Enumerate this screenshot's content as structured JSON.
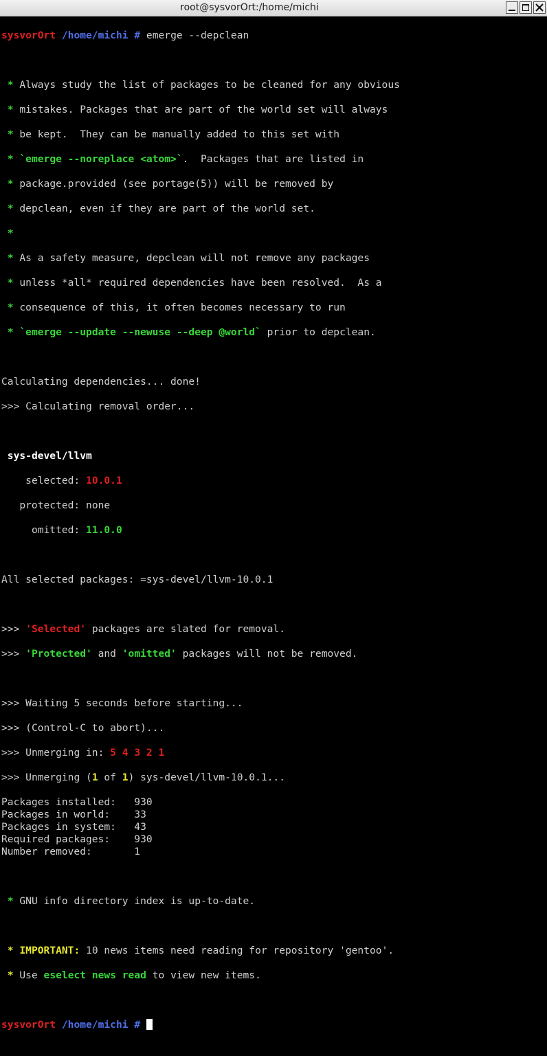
{
  "window": {
    "title": "root@sysvorOrt:/home/michi",
    "buttons": {
      "minimize_icon": "minimize-icon",
      "maximize_icon": "maximize-icon",
      "close_icon": "close-icon"
    }
  },
  "colors": {
    "host": "#e02020",
    "path": "#4f6fe8",
    "star": "#39d639",
    "important": "#e8e830"
  },
  "prompt": {
    "host": "sysvorOrt",
    "path": "/home/michi",
    "symbol": "#"
  },
  "command": "emerge --depclean",
  "warning": {
    "l1": "Always study the list of packages to be cleaned for any obvious",
    "l2": "mistakes. Packages that are part of the world set will always",
    "l3": "be kept.  They can be manually added to this set with",
    "l4_cmd": "`emerge --noreplace <atom>`",
    "l4_rest": ".  Packages that are listed in",
    "l5": "package.provided (see portage(5)) will be removed by",
    "l6": "depclean, even if they are part of the world set.",
    "l8": "As a safety measure, depclean will not remove any packages",
    "l9": "unless *all* required dependencies have been resolved.  As a",
    "l10": "consequence of this, it often becomes necessary to run",
    "l11_cmd": "`emerge --update --newuse --deep @world`",
    "l11_rest": " prior to depclean."
  },
  "calc": {
    "deps": "Calculating dependencies... done!",
    "order": ">>> Calculating removal order..."
  },
  "package": {
    "name": "sys-devel/llvm",
    "selected_label": "selected:",
    "selected_value": "10.0.1",
    "protected_label": "protected:",
    "protected_value": "none",
    "omitted_label": "omitted:",
    "omitted_value": "11.0.0"
  },
  "all_selected": "All selected packages: =sys-devel/llvm-10.0.1",
  "notes": {
    "arrow": ">>>",
    "selected_word": "'Selected'",
    "selected_rest": " packages are slated for removal.",
    "protected_word": "'Protected'",
    "and": " and ",
    "omitted_word": "'omitted'",
    "omitted_rest": " packages will not be removed."
  },
  "unmerge": {
    "waiting": "Waiting 5 seconds before starting...",
    "abort": "(Control-C to abort)...",
    "unmerging_in": "Unmerging in: ",
    "countdown": "5 4 3 2 1",
    "unmerging_pre": "Unmerging (",
    "cur": "1",
    "of": " of ",
    "total": "1",
    "unmerging_post": ") sys-devel/llvm-10.0.1..."
  },
  "stats": [
    {
      "label": "Packages installed:",
      "value": "930"
    },
    {
      "label": "Packages in world:",
      "value": "33"
    },
    {
      "label": "Packages in system:",
      "value": "43"
    },
    {
      "label": "Required packages:",
      "value": "930"
    },
    {
      "label": "Number removed:",
      "value": "1"
    }
  ],
  "info": "GNU info directory index is up-to-date.",
  "news": {
    "important": "IMPORTANT:",
    "important_rest": " 10 news items need reading for repository 'gentoo'.",
    "use": "Use ",
    "cmd": "eselect news read",
    "rest": " to view new items."
  }
}
